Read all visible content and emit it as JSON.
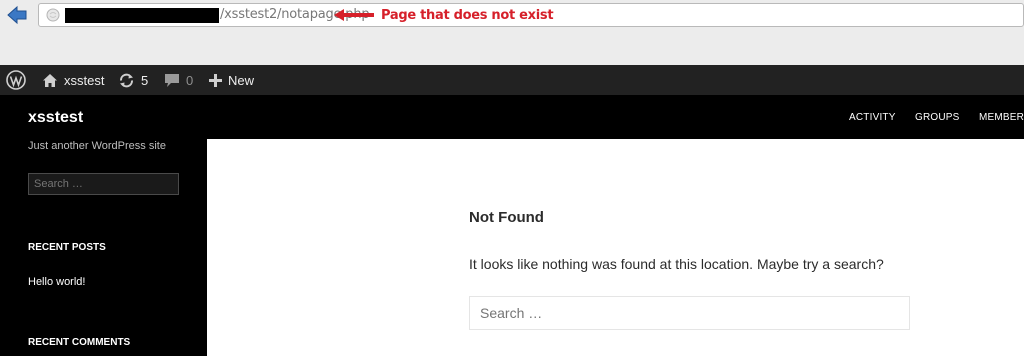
{
  "browser": {
    "url_path": "/xsstest2/notapage.php",
    "annotation": "Page that does not exist",
    "colors": {
      "annotation": "#d6202a",
      "url_text": "#777777"
    }
  },
  "adminbar": {
    "site_name": "xsstest",
    "updates_count": "5",
    "comments_count": "0",
    "new_label": "New"
  },
  "site": {
    "title": "xsstest",
    "description": "Just another WordPress site",
    "sidebar_search_placeholder": "Search …",
    "recent_posts_title": "RECENT POSTS",
    "recent_posts": [
      "Hello world!"
    ],
    "recent_comments_title": "RECENT COMMENTS"
  },
  "nav": {
    "items": [
      "ACTIVITY",
      "GROUPS",
      "MEMBERS"
    ]
  },
  "main": {
    "title": "Not Found",
    "message": "It looks like nothing was found at this location. Maybe try a search?",
    "search_placeholder": "Search …"
  }
}
